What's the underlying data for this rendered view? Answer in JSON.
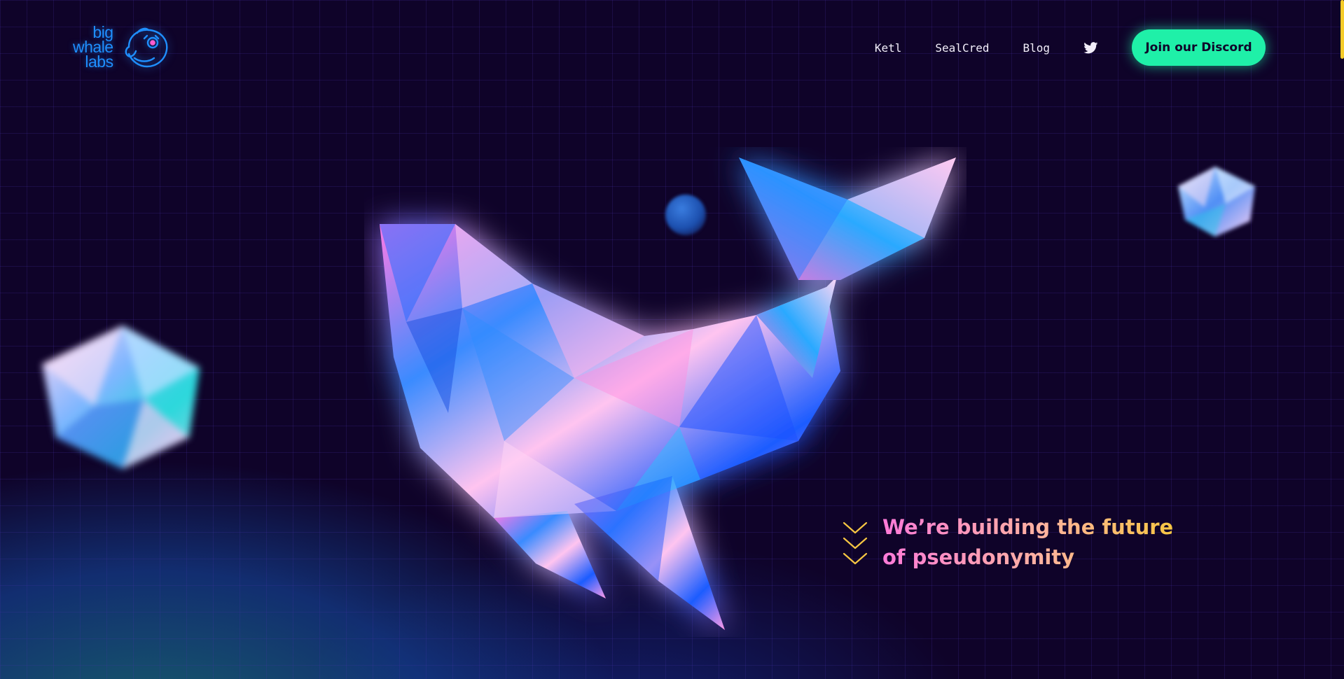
{
  "logo": {
    "lines": [
      "big",
      "whale",
      "labs"
    ]
  },
  "nav": {
    "links": [
      "Ketl",
      "SealCred",
      "Blog"
    ],
    "twitter_icon": "twitter-icon",
    "discord_button": "Join our Discord"
  },
  "hero": {
    "tagline_line1": "We’re building the future",
    "tagline_line2": "of pseudonymity",
    "chevron_icon": "chevron-down-icon"
  },
  "colors": {
    "background": "#0f0329",
    "accent_green": "#1ff0a8",
    "logo_blue": "#1f8fff",
    "tagline_pink": "#ff7ad9",
    "tagline_yellow": "#f6c643",
    "scroll_indicator": "#f5cb28"
  }
}
